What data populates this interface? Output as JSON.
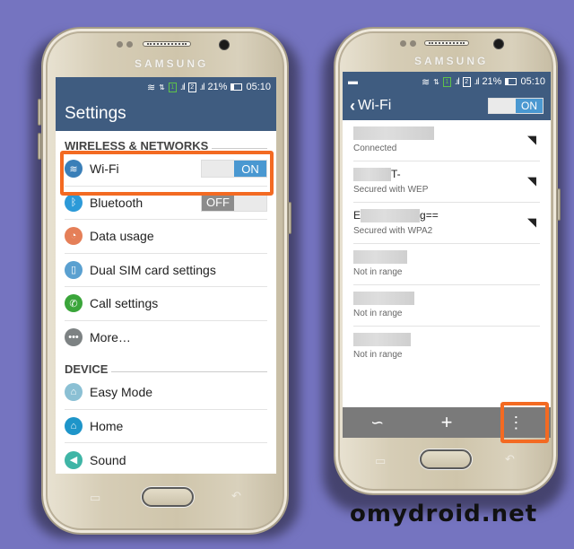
{
  "status_bar": {
    "battery": "21%",
    "time": "05:10",
    "sim1": "1",
    "sim2": "2"
  },
  "left_screen": {
    "title": "Settings",
    "sections": [
      {
        "header": "WIRELESS & NETWORKS",
        "items": [
          {
            "label": "Wi-Fi",
            "icon": "wifi-icon",
            "color": "#3a7fb8",
            "toggle": "ON"
          },
          {
            "label": "Bluetooth",
            "icon": "bluetooth-icon",
            "color": "#2c9ad8",
            "toggle": "OFF"
          },
          {
            "label": "Data usage",
            "icon": "data-usage-icon",
            "color": "#e57f58"
          },
          {
            "label": "Dual SIM card settings",
            "icon": "sim-card-icon",
            "color": "#5aa0d0"
          },
          {
            "label": "Call settings",
            "icon": "phone-icon",
            "color": "#3aa53a"
          },
          {
            "label": "More…",
            "icon": "more-icon",
            "color": "#7d8283"
          }
        ]
      },
      {
        "header": "DEVICE",
        "items": [
          {
            "label": "Easy Mode",
            "icon": "easy-mode-icon",
            "color": "#8bc0d4"
          },
          {
            "label": "Home",
            "icon": "home-icon",
            "color": "#1e95c9"
          },
          {
            "label": "Sound",
            "icon": "sound-icon",
            "color": "#3fb5a6"
          }
        ]
      }
    ]
  },
  "right_screen": {
    "title": "Wi-Fi",
    "toggle": "ON",
    "networks": [
      {
        "ssid_visible": "",
        "status": "Connected"
      },
      {
        "ssid_visible": "T-",
        "status": "Secured with WEP"
      },
      {
        "ssid_visible_prefix": "E",
        "ssid_visible": "g==",
        "status": "Secured with WPA2"
      },
      {
        "ssid_visible": "",
        "status": "Not in range"
      },
      {
        "ssid_visible": "",
        "status": "Not in range"
      },
      {
        "ssid_visible": "",
        "status": "Not in range"
      }
    ],
    "bottom_actions": [
      "wps-icon",
      "add-network-icon",
      "more-options-icon"
    ]
  },
  "phone": {
    "brand": "SAMSUNG"
  },
  "watermark": "omydroid.net",
  "colors": {
    "background": "#7574c0",
    "header": "#3f5c80",
    "highlight": "#f36a22",
    "toggle_on": "#4a98d1"
  }
}
